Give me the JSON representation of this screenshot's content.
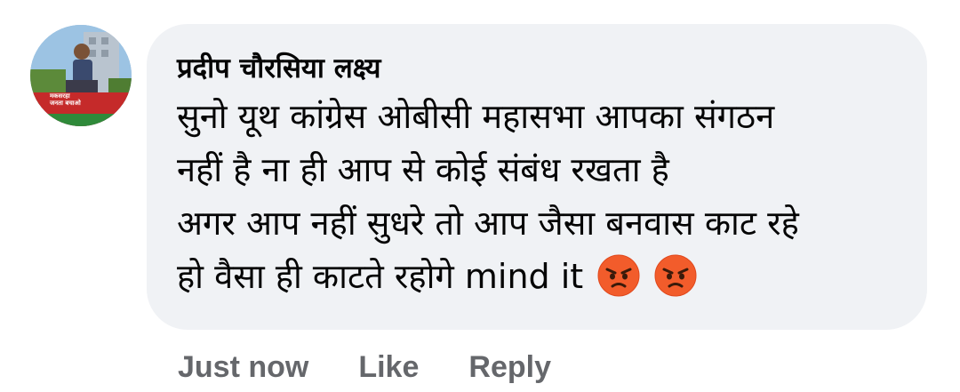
{
  "comment": {
    "author": "प्रदीप चौरसिया लक्ष्य",
    "lines": [
      "सुनो यूथ कांग्रेस ओबीसी महासभा आपका संगठन",
      "नहीं है ना ही आप से कोई संबंध रखता है",
      "अगर आप नहीं सुधरे तो आप जैसा बनवास काट रहे",
      "हो वैसा ही काटते रहोगे mind it"
    ],
    "emojis": [
      "angry-face-emoji",
      "angry-face-emoji"
    ],
    "avatar_caption": [
      "मकसरहा",
      "जनता बचाओ"
    ]
  },
  "actions": {
    "timestamp": "Just now",
    "like_label": "Like",
    "reply_label": "Reply"
  },
  "colors": {
    "bubble": "#f0f2f5",
    "text": "#050505",
    "secondary_text": "#65676b",
    "emoji_face": "#f25c2b"
  }
}
